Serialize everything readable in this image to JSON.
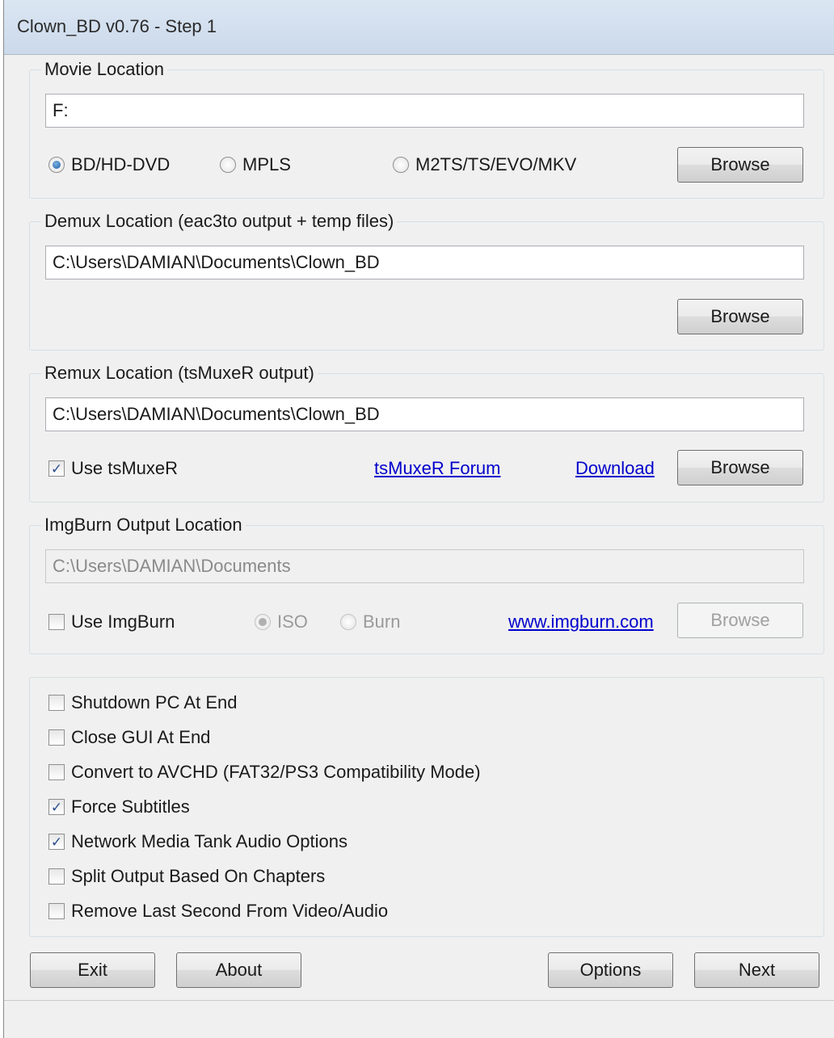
{
  "window": {
    "title": "Clown_BD v0.76 - Step 1"
  },
  "movie_location": {
    "label": "Movie Location",
    "path": "F:",
    "options": [
      "BD/HD-DVD",
      "MPLS",
      "M2TS/TS/EVO/MKV"
    ],
    "selected": "BD/HD-DVD",
    "browse_label": "Browse"
  },
  "demux_location": {
    "label": "Demux Location (eac3to output + temp files)",
    "path": "C:\\Users\\DAMIAN\\Documents\\Clown_BD",
    "browse_label": "Browse"
  },
  "remux_location": {
    "label": "Remux Location (tsMuxeR output)",
    "path": "C:\\Users\\DAMIAN\\Documents\\Clown_BD",
    "use_label": "Use tsMuxeR",
    "use_checked": true,
    "forum_link": "tsMuxeR Forum",
    "download_link": "Download",
    "browse_label": "Browse"
  },
  "imgburn_location": {
    "label": "ImgBurn Output Location",
    "path": "C:\\Users\\DAMIAN\\Documents",
    "use_label": "Use ImgBurn",
    "use_checked": false,
    "options": [
      "ISO",
      "Burn"
    ],
    "selected": "ISO",
    "site_link": "www.imgburn.com",
    "browse_label": "Browse"
  },
  "options": [
    {
      "label": "Shutdown PC At End",
      "checked": false
    },
    {
      "label": "Close GUI At End",
      "checked": false
    },
    {
      "label": "Convert to AVCHD (FAT32/PS3 Compatibility Mode)",
      "checked": false
    },
    {
      "label": "Force Subtitles",
      "checked": true
    },
    {
      "label": "Network Media Tank Audio Options",
      "checked": true
    },
    {
      "label": "Split Output Based On Chapters",
      "checked": false
    },
    {
      "label": "Remove Last Second From Video/Audio",
      "checked": false
    }
  ],
  "footer": {
    "exit_label": "Exit",
    "about_label": "About",
    "options_label": "Options",
    "next_label": "Next"
  },
  "check_glyph": "✓"
}
